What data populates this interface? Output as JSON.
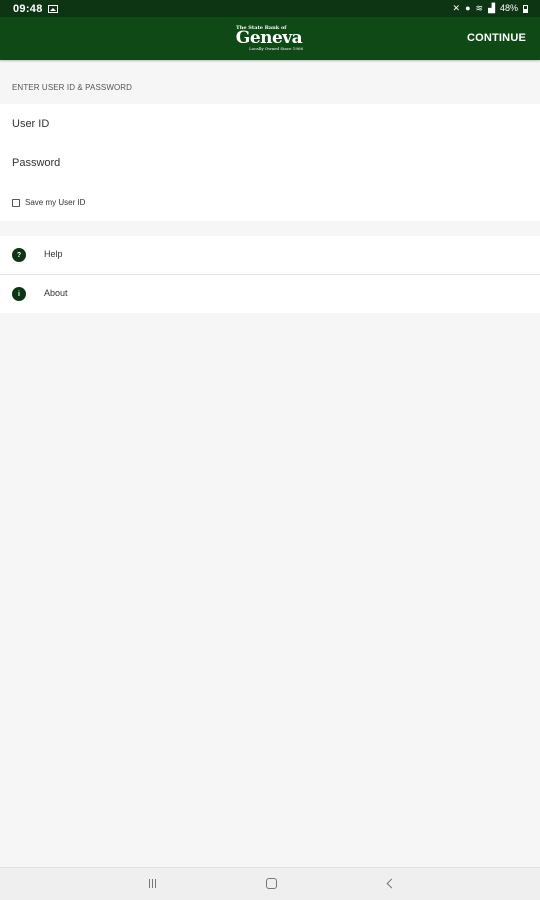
{
  "status_bar": {
    "time": "09:48",
    "battery": "48%"
  },
  "app_bar": {
    "logo_top": "The State Bank of",
    "logo_main": "Geneva",
    "logo_bottom": "Locally Owned Since 1906",
    "continue_label": "CONTINUE"
  },
  "form": {
    "section_header": "ENTER USER ID & PASSWORD",
    "user_id_placeholder": "User ID",
    "user_id_value": "",
    "password_placeholder": "Password",
    "password_value": "",
    "save_user_id_label": "Save my User ID",
    "save_user_id_checked": false
  },
  "menu": {
    "items": [
      {
        "label": "Help",
        "icon": "help-icon",
        "icon_glyph": "?"
      },
      {
        "label": "About",
        "icon": "info-icon",
        "icon_glyph": "i"
      }
    ]
  },
  "colors": {
    "app_bar": "#0f4a16",
    "status_bar": "#0d3514",
    "background": "#f6f6f6"
  }
}
